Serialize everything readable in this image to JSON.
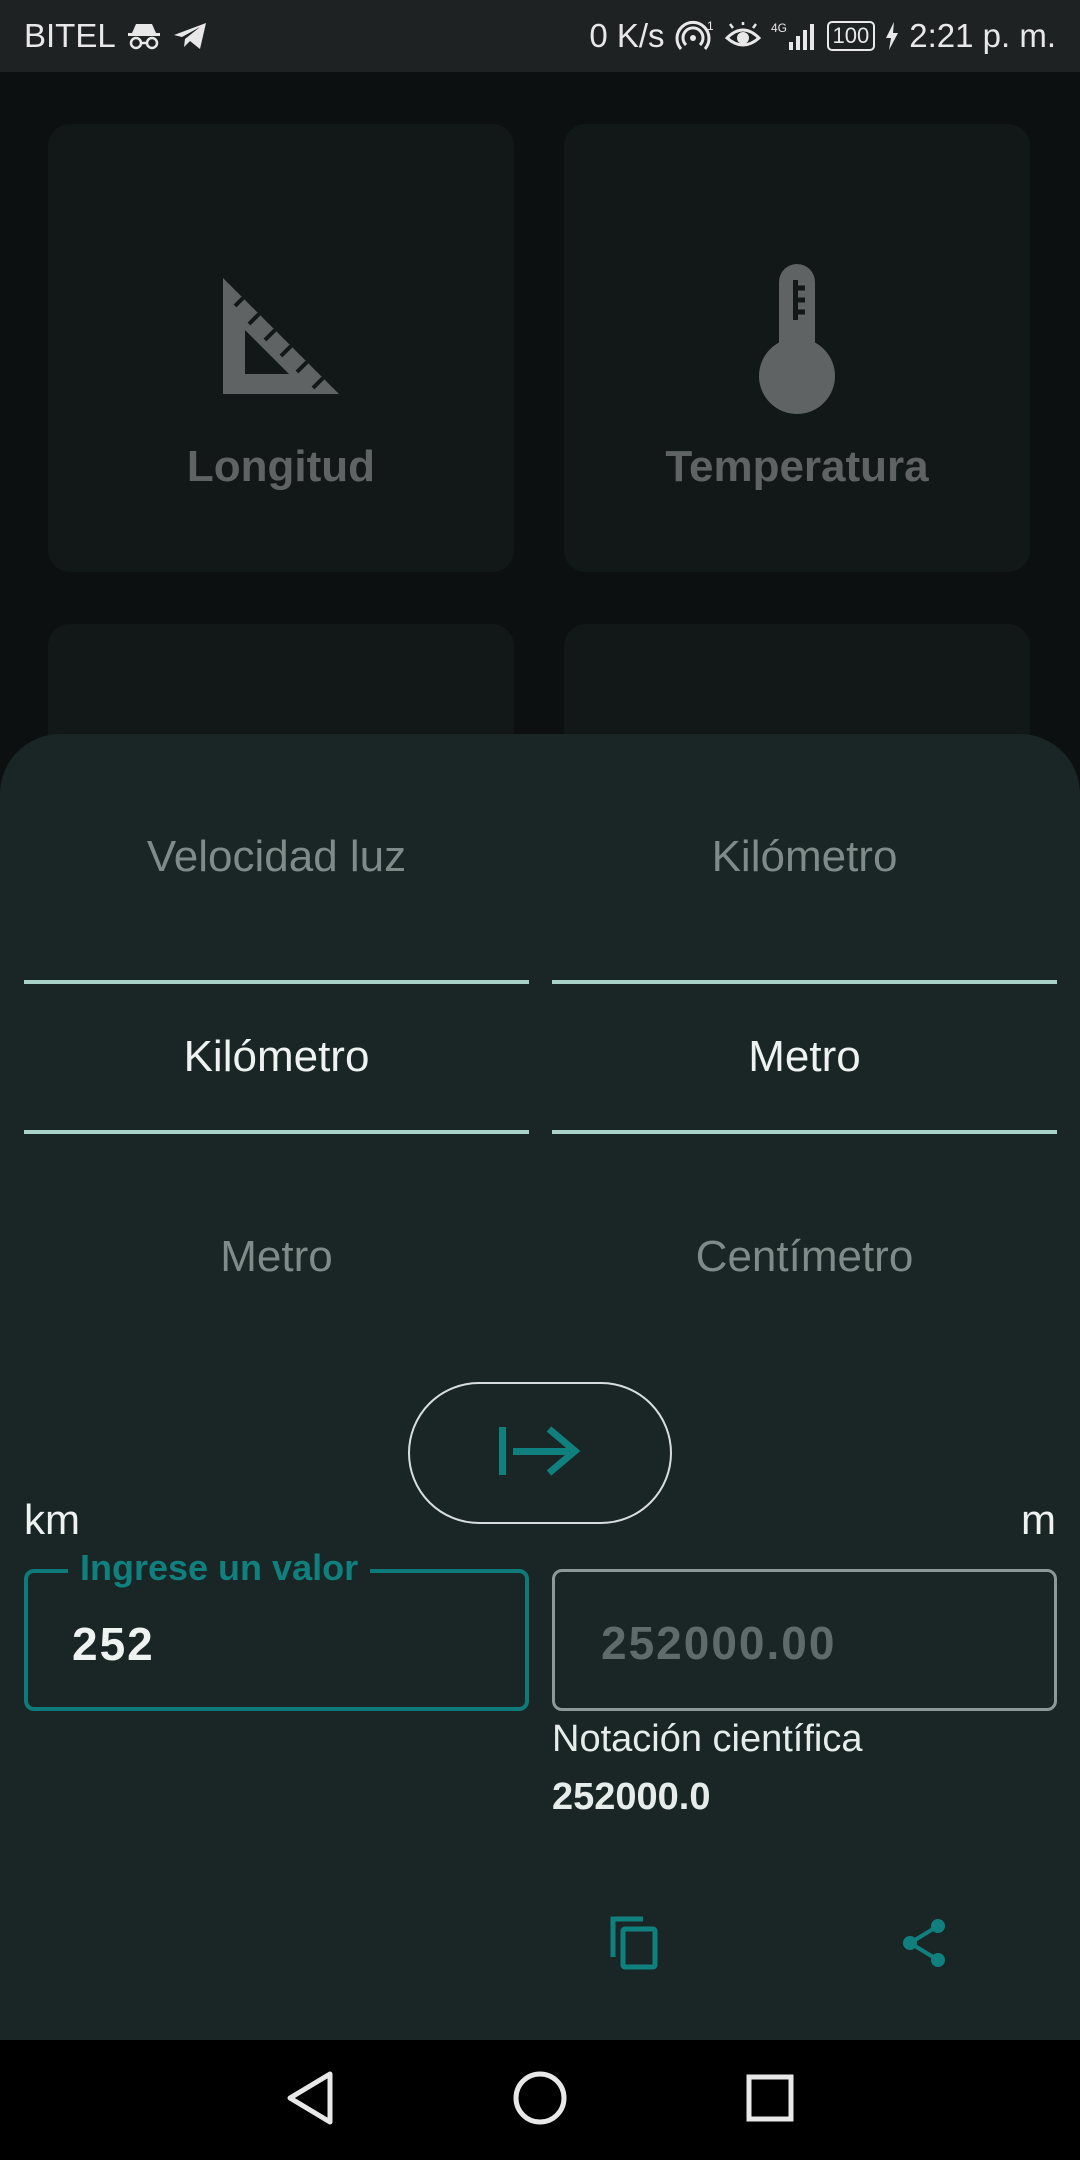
{
  "status_bar": {
    "carrier": "BITEL",
    "speed": "0 K/s",
    "network": "4G",
    "battery": "100",
    "time": "2:21 p. m."
  },
  "categories": [
    {
      "label": "Longitud",
      "icon": "ruler-triangle-icon"
    },
    {
      "label": "Temperatura",
      "icon": "thermometer-icon"
    }
  ],
  "converter": {
    "from_options": {
      "above": "Velocidad luz",
      "selected": "Kilómetro",
      "below": "Metro"
    },
    "to_options": {
      "above": "Kilómetro",
      "selected": "Metro",
      "below": "Centímetro"
    },
    "from_unit": "km",
    "to_unit": "m",
    "input_label": "Ingrese un valor",
    "input_value": "252",
    "output_value": "252000.00",
    "scientific_label": "Notación científica",
    "scientific_value": "252000.0"
  },
  "colors": {
    "accent": "#10807f",
    "sheet_background": "#1a2526",
    "divider": "#a9d2c8"
  }
}
